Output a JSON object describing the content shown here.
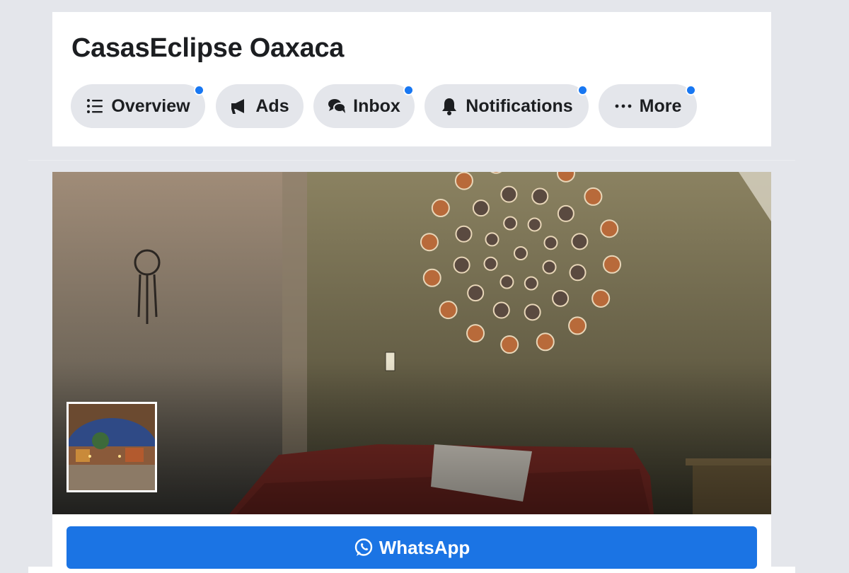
{
  "page": {
    "title": "CasasEclipse Oaxaca"
  },
  "tabs": [
    {
      "label": "Overview",
      "icon": "list-icon",
      "has_dot": true
    },
    {
      "label": "Ads",
      "icon": "megaphone-icon",
      "has_dot": false
    },
    {
      "label": "Inbox",
      "icon": "chat-bubbles-icon",
      "has_dot": true
    },
    {
      "label": "Notifications",
      "icon": "bell-icon",
      "has_dot": true
    },
    {
      "label": "More",
      "icon": "more-dots-icon",
      "has_dot": true
    }
  ],
  "cover": {
    "description_icon": "cover-photo"
  },
  "profile": {
    "icon": "profile-photo"
  },
  "cta": {
    "label": "WhatsApp",
    "icon": "whatsapp-icon"
  },
  "colors": {
    "accent": "#1b74e4",
    "notification_dot": "#1877f2",
    "tab_bg": "#e4e6eb",
    "page_bg": "#e4e6eb"
  }
}
